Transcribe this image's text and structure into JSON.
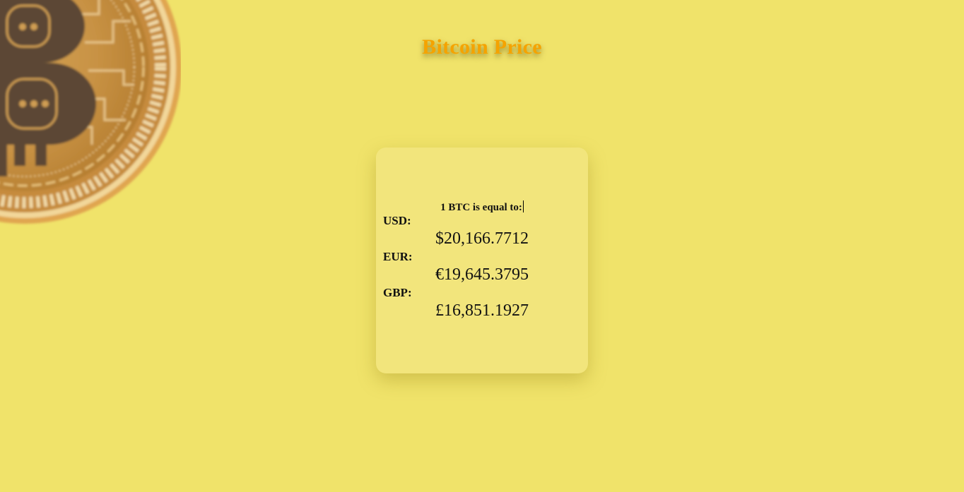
{
  "header": {
    "title": "Bitcoin Price"
  },
  "card": {
    "intro": "1 BTC is equal to:",
    "rates": [
      {
        "label": "USD:",
        "value": "$20,166.7712"
      },
      {
        "label": "EUR:",
        "value": "€19,645.3795"
      },
      {
        "label": "GBP:",
        "value": "£16,851.1927"
      }
    ]
  },
  "colors": {
    "background": "#f0e36a",
    "card": "#f2e57c",
    "title": "#f5a300"
  },
  "icons": {
    "coin": "bitcoin-coin-icon"
  }
}
